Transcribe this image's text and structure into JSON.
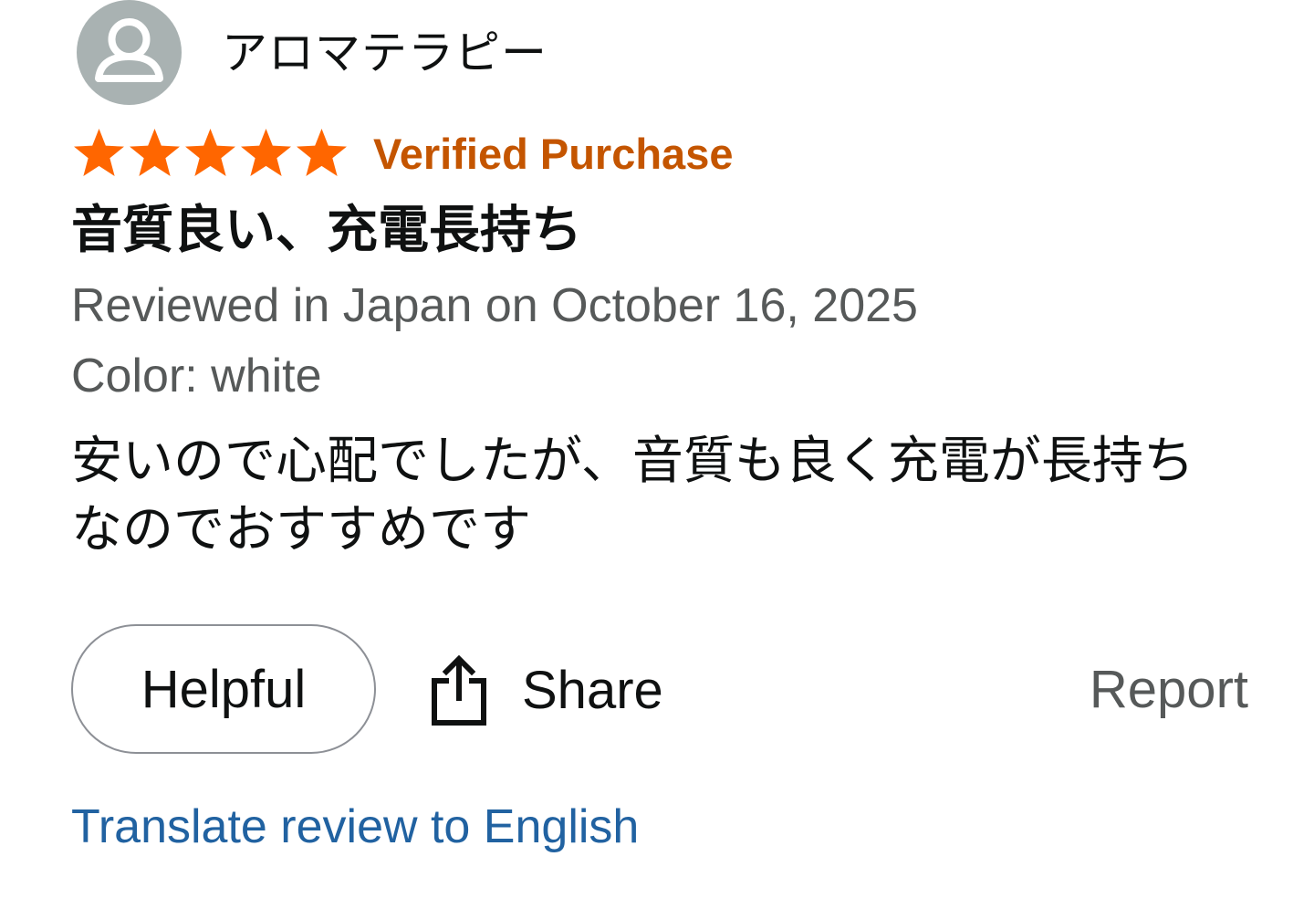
{
  "reviewer": {
    "name": "アロマテラピー",
    "avatar_icon": "user-silhouette-icon"
  },
  "rating": {
    "stars": 5,
    "max": 5,
    "star_color": "#ff6600",
    "verified_label": "Verified Purchase",
    "verified_color": "#c45500"
  },
  "review": {
    "title": "音質良い、充電長持ち",
    "date_line": "Reviewed in Japan on October 16, 2025",
    "variant_line": "Color: white",
    "body": "安いので心配でしたが、音質も良く充電が長持ちなのでおすすめです"
  },
  "actions": {
    "helpful_label": "Helpful",
    "share_label": "Share",
    "share_icon": "share-upload-icon",
    "report_label": "Report"
  },
  "translate": {
    "label": "Translate review to English",
    "color": "#2162a1"
  }
}
